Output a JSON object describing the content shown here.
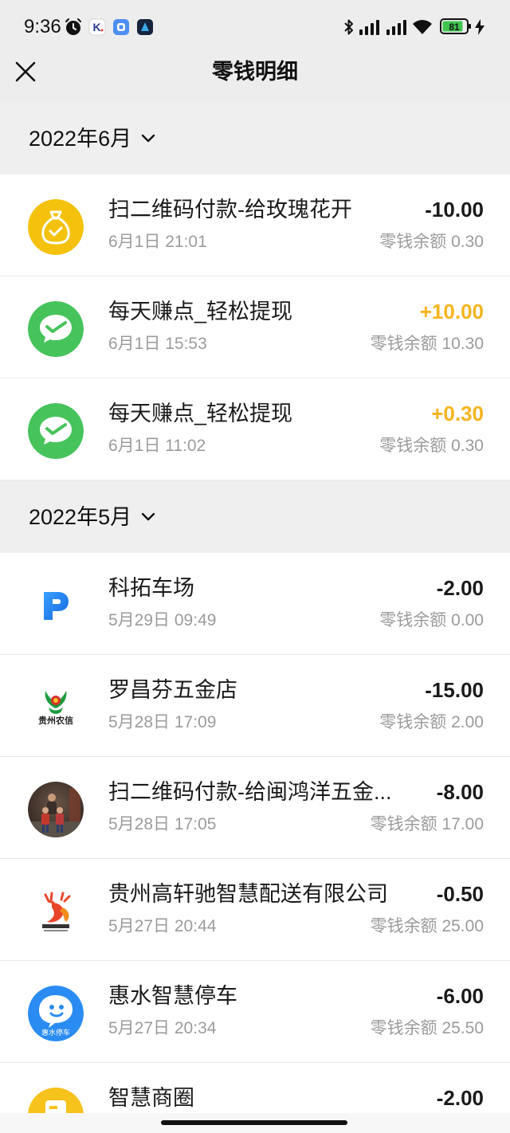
{
  "status_bar": {
    "time": "9:36",
    "k_app_letter": "K",
    "battery_level": "81",
    "left_icons": [
      "alarm-icon",
      "k-app-icon",
      "blue-app-icon",
      "dark-app-icon"
    ],
    "right_icons": [
      "bluetooth-icon",
      "signal-icon",
      "signal-icon",
      "wifi-icon",
      "battery-icon",
      "charging-icon"
    ]
  },
  "header": {
    "title": "零钱明细",
    "close_icon": "close-icon"
  },
  "colors": {
    "page_bg": "#ededed",
    "primary_text": "#1a1a1a",
    "secondary_text": "#9b9b9b",
    "income": "#f5b41f",
    "expense": "#1a1a1a",
    "wechat_green": "#46c35b"
  },
  "groups": [
    {
      "month": "2022年6月",
      "items": [
        {
          "icon": "money-bag-icon",
          "title": "扫二维码付款-给玫瑰花开",
          "time": "6月1日 21:01",
          "amount": "-10.00",
          "amount_color": "#1a1a1a",
          "balance": "零钱余额 0.30"
        },
        {
          "icon": "wechat-pay-icon",
          "title": "每天赚点_轻松提现",
          "time": "6月1日 15:53",
          "amount": "+10.00",
          "amount_color": "#f5b41f",
          "balance": "零钱余额 10.30"
        },
        {
          "icon": "wechat-pay-icon",
          "title": "每天赚点_轻松提现",
          "time": "6月1日 11:02",
          "amount": "+0.30",
          "amount_color": "#f5b41f",
          "balance": "零钱余额 0.30"
        }
      ]
    },
    {
      "month": "2022年5月",
      "items": [
        {
          "icon": "parking-p-logo-icon",
          "title": "科拓车场",
          "time": "5月29日 09:49",
          "amount": "-2.00",
          "amount_color": "#1a1a1a",
          "balance": "零钱余额 0.00"
        },
        {
          "icon": "rural-credit-logo-icon",
          "logo_text": "贵州农信",
          "title": "罗昌芬五金店",
          "time": "5月28日 17:09",
          "amount": "-15.00",
          "amount_color": "#1a1a1a",
          "balance": "零钱余额 2.00"
        },
        {
          "icon": "photo-avatar-icon",
          "title": "扫二维码付款-给闽鸿洋五金...",
          "time": "5月28日 17:05",
          "amount": "-8.00",
          "amount_color": "#1a1a1a",
          "balance": "零钱余额 17.00"
        },
        {
          "icon": "deer-logo-icon",
          "title": "贵州高轩驰智慧配送有限公司",
          "time": "5月27日 20:44",
          "amount": "-0.50",
          "amount_color": "#1a1a1a",
          "balance": "零钱余额 25.00"
        },
        {
          "icon": "parking-app-logo-icon",
          "logo_text": "惠水停车",
          "title": "惠水智慧停车",
          "time": "5月27日 20:34",
          "amount": "-6.00",
          "amount_color": "#1a1a1a",
          "balance": "零钱余额 25.50"
        },
        {
          "icon": "store-logo-icon",
          "title": "智慧商圈",
          "amount": "-2.00",
          "amount_color": "#1a1a1a"
        }
      ]
    }
  ]
}
